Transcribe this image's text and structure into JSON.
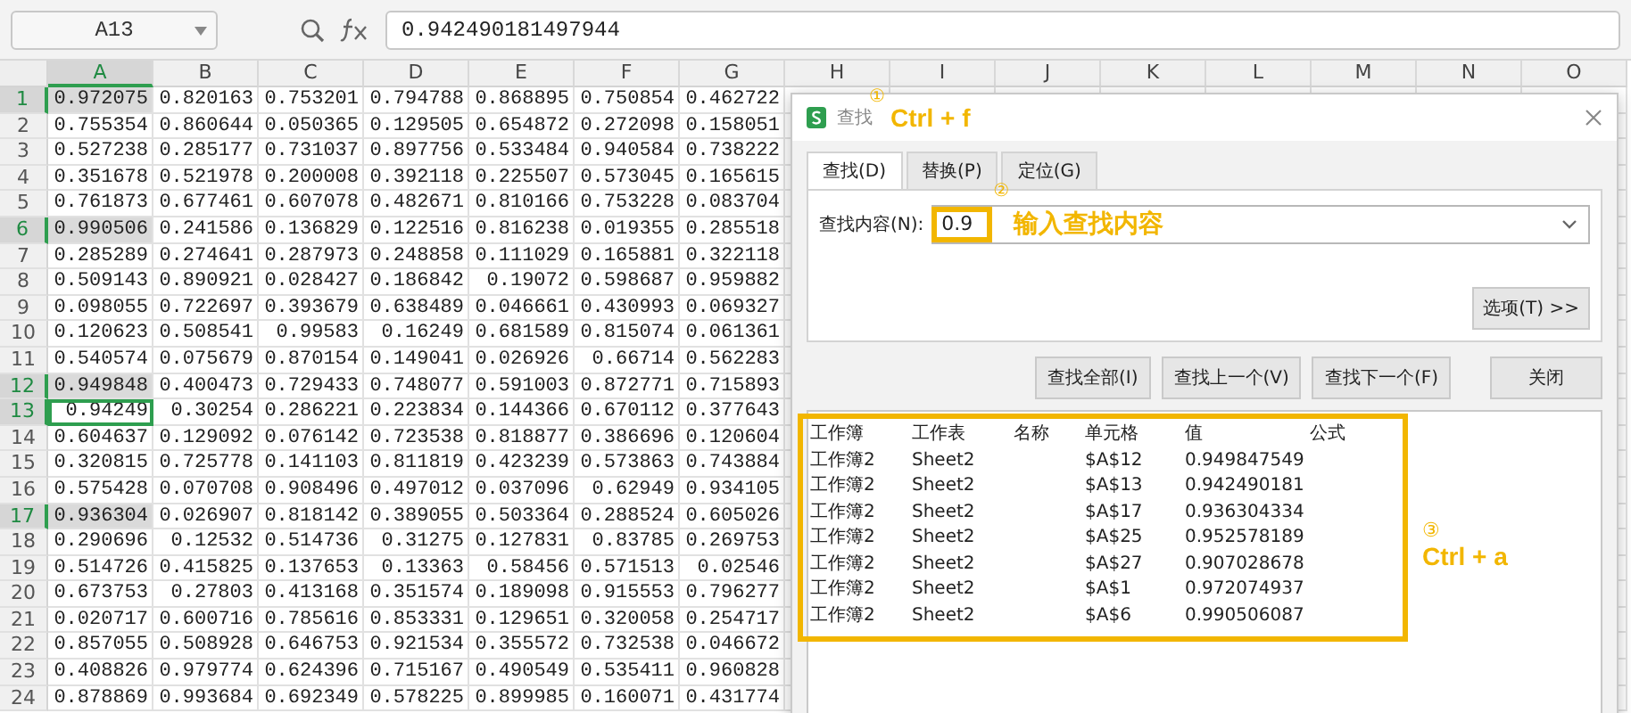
{
  "toolbar": {
    "name_box": "A13",
    "formula": "0.942490181497944"
  },
  "columns": [
    {
      "label": "A",
      "selected": true
    },
    {
      "label": "B",
      "selected": false
    },
    {
      "label": "C",
      "selected": false
    },
    {
      "label": "D",
      "selected": false
    },
    {
      "label": "E",
      "selected": false
    },
    {
      "label": "F",
      "selected": false
    },
    {
      "label": "G",
      "selected": false
    },
    {
      "label": "H",
      "selected": false
    },
    {
      "label": "I",
      "selected": false
    },
    {
      "label": "J",
      "selected": false
    },
    {
      "label": "K",
      "selected": false
    },
    {
      "label": "L",
      "selected": false
    },
    {
      "label": "M",
      "selected": false
    },
    {
      "label": "N",
      "selected": false
    },
    {
      "label": "O",
      "selected": false
    }
  ],
  "rows": [
    {
      "header": "1",
      "selected": true,
      "active": false,
      "cells": [
        "0.972075",
        "0.820163",
        "0.753201",
        "0.794788",
        "0.868895",
        "0.750854",
        "0.462722"
      ]
    },
    {
      "header": "2",
      "selected": false,
      "active": false,
      "cells": [
        "0.755354",
        "0.860644",
        "0.050365",
        "0.129505",
        "0.654872",
        "0.272098",
        "0.158051"
      ]
    },
    {
      "header": "3",
      "selected": false,
      "active": false,
      "cells": [
        "0.527238",
        "0.285177",
        "0.731037",
        "0.897756",
        "0.533484",
        "0.940584",
        "0.738222"
      ]
    },
    {
      "header": "4",
      "selected": false,
      "active": false,
      "cells": [
        "0.351678",
        "0.521978",
        "0.200008",
        "0.392118",
        "0.225507",
        "0.573045",
        "0.165615"
      ]
    },
    {
      "header": "5",
      "selected": false,
      "active": false,
      "cells": [
        "0.761873",
        "0.677461",
        "0.607078",
        "0.482671",
        "0.810166",
        "0.753228",
        "0.083704"
      ]
    },
    {
      "header": "6",
      "selected": true,
      "active": false,
      "cells": [
        "0.990506",
        "0.241586",
        "0.136829",
        "0.122516",
        "0.816238",
        "0.019355",
        "0.285518"
      ]
    },
    {
      "header": "7",
      "selected": false,
      "active": false,
      "cells": [
        "0.285289",
        "0.274641",
        "0.287973",
        "0.248858",
        "0.111029",
        "0.165881",
        "0.322118"
      ]
    },
    {
      "header": "8",
      "selected": false,
      "active": false,
      "cells": [
        "0.509143",
        "0.890921",
        "0.028427",
        "0.186842",
        "0.19072",
        "0.598687",
        "0.959882"
      ]
    },
    {
      "header": "9",
      "selected": false,
      "active": false,
      "cells": [
        "0.098055",
        "0.722697",
        "0.393679",
        "0.638489",
        "0.046661",
        "0.430993",
        "0.069327"
      ]
    },
    {
      "header": "10",
      "selected": false,
      "active": false,
      "cells": [
        "0.120623",
        "0.508541",
        "0.99583",
        "0.16249",
        "0.681589",
        "0.815074",
        "0.061361"
      ]
    },
    {
      "header": "11",
      "selected": false,
      "active": false,
      "cells": [
        "0.540574",
        "0.075679",
        "0.870154",
        "0.149041",
        "0.026926",
        "0.66714",
        "0.562283"
      ]
    },
    {
      "header": "12",
      "selected": true,
      "active": false,
      "cells": [
        "0.949848",
        "0.400473",
        "0.729433",
        "0.748077",
        "0.591003",
        "0.872771",
        "0.715893"
      ]
    },
    {
      "header": "13",
      "selected": true,
      "active": true,
      "cells": [
        "0.94249",
        "0.30254",
        "0.286221",
        "0.223834",
        "0.144366",
        "0.670112",
        "0.377643"
      ]
    },
    {
      "header": "14",
      "selected": false,
      "active": false,
      "cells": [
        "0.604637",
        "0.129092",
        "0.076142",
        "0.723538",
        "0.818877",
        "0.386696",
        "0.120604"
      ]
    },
    {
      "header": "15",
      "selected": false,
      "active": false,
      "cells": [
        "0.320815",
        "0.725778",
        "0.141103",
        "0.811819",
        "0.423239",
        "0.573863",
        "0.743884"
      ]
    },
    {
      "header": "16",
      "selected": false,
      "active": false,
      "cells": [
        "0.575428",
        "0.070708",
        "0.908496",
        "0.497012",
        "0.037096",
        "0.62949",
        "0.934105"
      ]
    },
    {
      "header": "17",
      "selected": true,
      "active": false,
      "cells": [
        "0.936304",
        "0.026907",
        "0.818142",
        "0.389055",
        "0.503364",
        "0.288524",
        "0.605026"
      ]
    },
    {
      "header": "18",
      "selected": false,
      "active": false,
      "cells": [
        "0.290696",
        "0.12532",
        "0.514736",
        "0.31275",
        "0.127831",
        "0.83785",
        "0.269753"
      ]
    },
    {
      "header": "19",
      "selected": false,
      "active": false,
      "cells": [
        "0.514726",
        "0.415825",
        "0.137653",
        "0.13363",
        "0.58456",
        "0.571513",
        "0.02546"
      ]
    },
    {
      "header": "20",
      "selected": false,
      "active": false,
      "cells": [
        "0.673753",
        "0.27803",
        "0.413168",
        "0.351574",
        "0.189098",
        "0.915553",
        "0.796277"
      ]
    },
    {
      "header": "21",
      "selected": false,
      "active": false,
      "cells": [
        "0.020717",
        "0.600716",
        "0.785616",
        "0.853331",
        "0.129651",
        "0.320058",
        "0.254717"
      ]
    },
    {
      "header": "22",
      "selected": false,
      "active": false,
      "cells": [
        "0.857055",
        "0.508928",
        "0.646753",
        "0.921534",
        "0.355572",
        "0.732538",
        "0.046672"
      ]
    },
    {
      "header": "23",
      "selected": false,
      "active": false,
      "cells": [
        "0.408826",
        "0.979774",
        "0.624396",
        "0.715167",
        "0.490549",
        "0.535411",
        "0.960828"
      ]
    },
    {
      "header": "24",
      "selected": false,
      "active": false,
      "cells": [
        "0.878869",
        "0.993684",
        "0.692349",
        "0.578225",
        "0.899985",
        "0.160071",
        "0.431774"
      ]
    }
  ],
  "dialog": {
    "title": "查找",
    "tabs": [
      {
        "label": "查找(D)",
        "selected": true
      },
      {
        "label": "替换(P)",
        "selected": false
      },
      {
        "label": "定位(G)",
        "selected": false
      }
    ],
    "find_label": "查找内容(N):",
    "find_value": "0.9",
    "options_button": "选项(T) >>",
    "buttons": [
      "查找全部(I)",
      "查找上一个(V)",
      "查找下一个(F)",
      "关闭"
    ],
    "results": {
      "columns": [
        "工作簿",
        "工作表",
        "名称",
        "单元格",
        "值",
        "公式"
      ],
      "rows": [
        {
          "workbook": "工作簿2",
          "sheet": "Sheet2",
          "cell": "$A$12",
          "value": "0.949847549"
        },
        {
          "workbook": "工作簿2",
          "sheet": "Sheet2",
          "cell": "$A$13",
          "value": "0.942490181"
        },
        {
          "workbook": "工作簿2",
          "sheet": "Sheet2",
          "cell": "$A$17",
          "value": "0.936304334"
        },
        {
          "workbook": "工作簿2",
          "sheet": "Sheet2",
          "cell": "$A$25",
          "value": "0.952578189"
        },
        {
          "workbook": "工作簿2",
          "sheet": "Sheet2",
          "cell": "$A$27",
          "value": "0.907028678"
        },
        {
          "workbook": "工作簿2",
          "sheet": "Sheet2",
          "cell": "$A$1",
          "value": "0.972074937"
        },
        {
          "workbook": "工作簿2",
          "sheet": "Sheet2",
          "cell": "$A$6",
          "value": "0.990506087"
        }
      ]
    }
  },
  "annotations": [
    {
      "number": "①",
      "text": "Ctrl + f"
    },
    {
      "number": "②",
      "text": "输入查找内容"
    },
    {
      "number": "③",
      "text": "Ctrl + a"
    }
  ]
}
